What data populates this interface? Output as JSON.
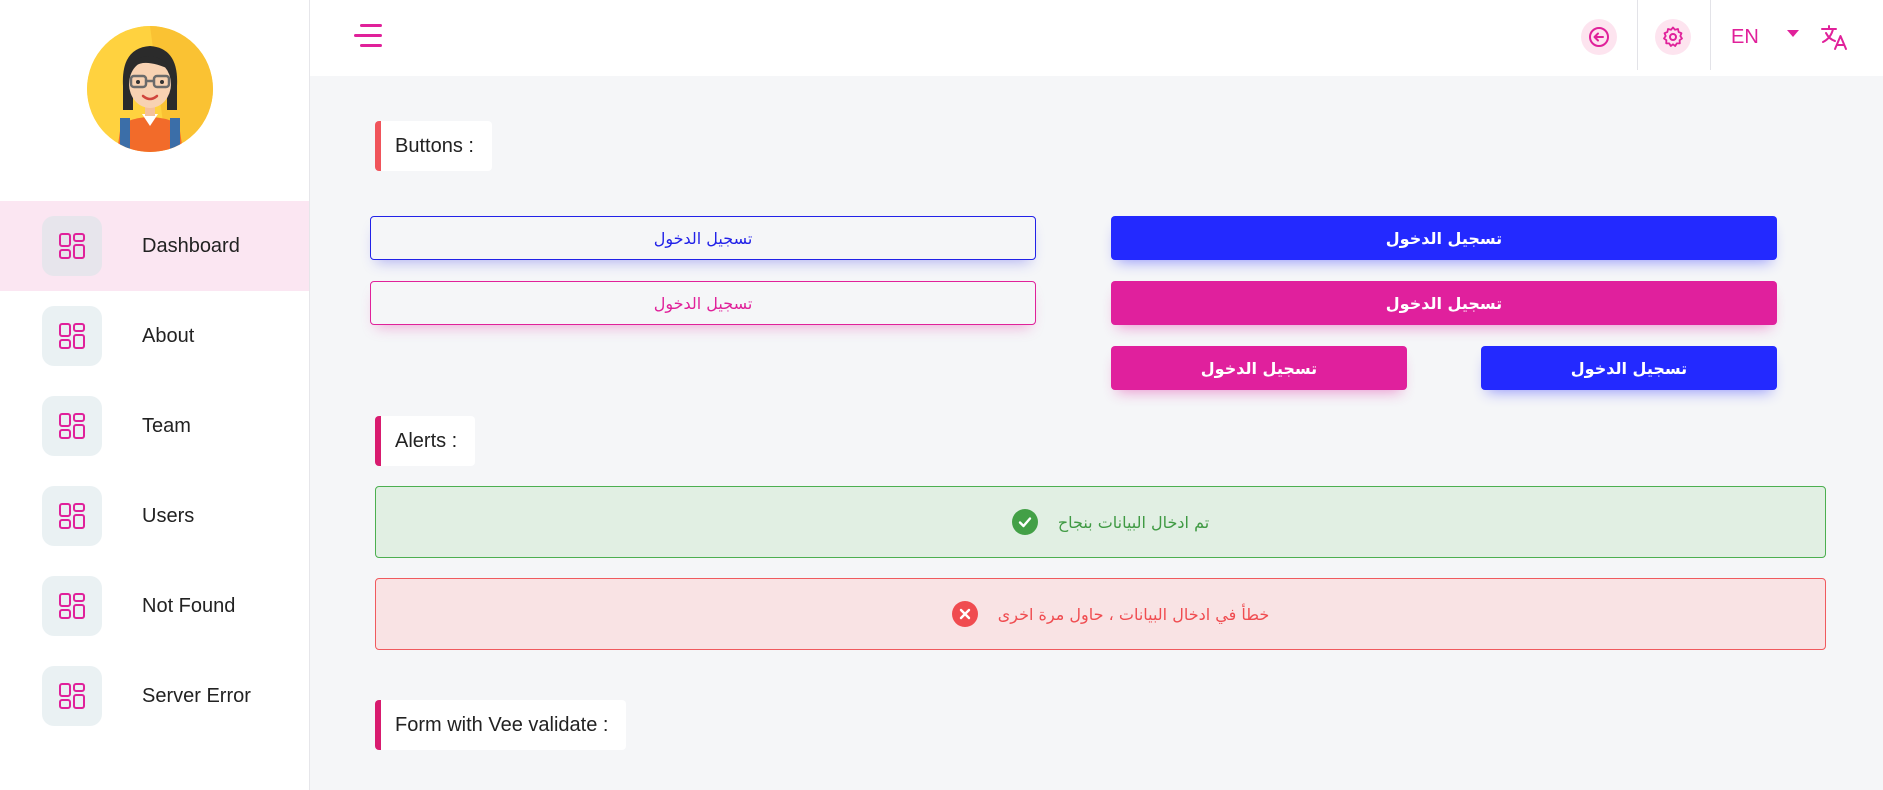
{
  "sidebar": {
    "items": [
      {
        "label": "Dashboard",
        "active": true
      },
      {
        "label": "About"
      },
      {
        "label": "Team"
      },
      {
        "label": "Users"
      },
      {
        "label": "Not Found"
      },
      {
        "label": "Server Error"
      }
    ]
  },
  "topbar": {
    "language": "EN",
    "icons": [
      "menu-toggle-icon",
      "logout-icon",
      "settings-icon",
      "chevron-down-icon",
      "translate-icon"
    ]
  },
  "sections": {
    "buttons_title": "Buttons :",
    "alerts_title": "Alerts :",
    "form_title": "Form with Vee validate :"
  },
  "buttons": {
    "outline_blue": "تسجيل الدخول",
    "outline_pink": "تسجيل الدخول",
    "solid_blue_wide": "تسجيل الدخول",
    "solid_pink_wide": "تسجيل الدخول",
    "solid_blue_small": "تسجيل الدخول",
    "solid_pink_small": "تسجيل الدخول"
  },
  "alerts": {
    "success": "تم ادخال البيانات بنجاح",
    "error": "خطأ في ادخال البيانات ، حاول مرة اخرى"
  },
  "colors": {
    "accent_pink": "#e0219a",
    "primary_blue": "#2329ff",
    "success_green": "#43a047",
    "error_red": "#f04c50"
  }
}
